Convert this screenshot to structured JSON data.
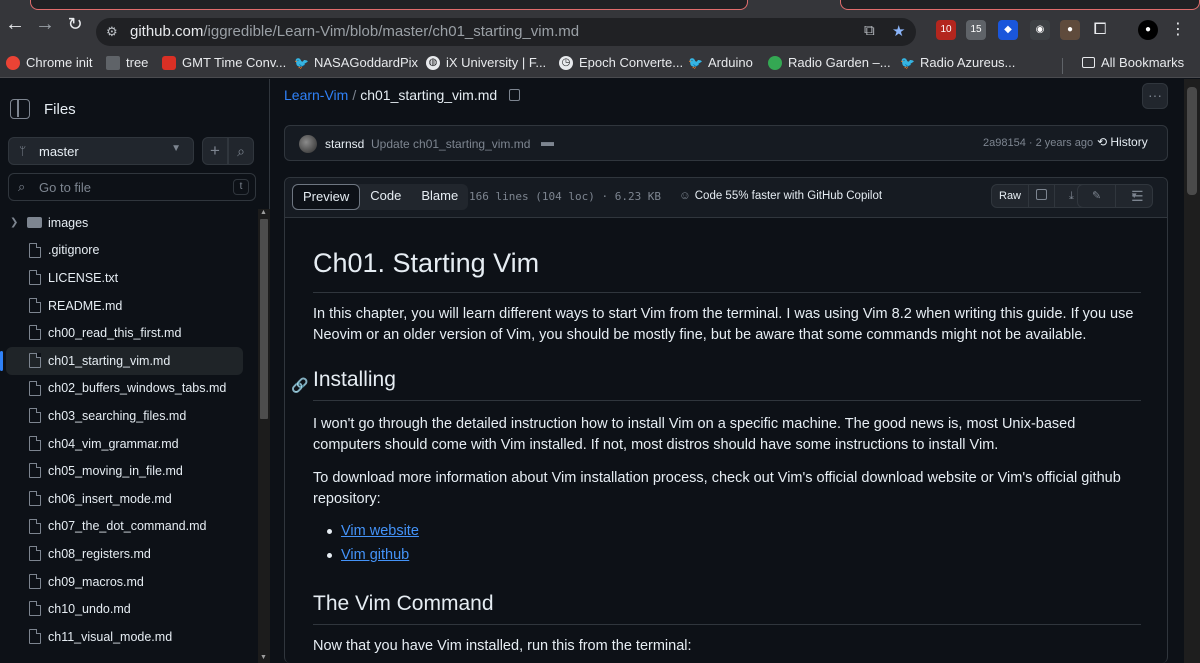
{
  "browser": {
    "url_host": "github.com",
    "url_path": "/iggredible/Learn-Vim/blob/master/ch01_starting_vim.md",
    "ext_badges": [
      "10",
      "15"
    ],
    "bookmarks": [
      "Chrome init",
      "tree",
      "GMT Time Conv...",
      "NASAGoddardPix",
      "iX University | F...",
      "Epoch Converte...",
      "Arduino",
      "Radio Garden –...",
      "Radio Azureus..."
    ],
    "all_bookmarks": "All Bookmarks"
  },
  "sidebar": {
    "title": "Files",
    "branch": "master",
    "goto_placeholder": "Go to file",
    "goto_kbd": "t",
    "items": [
      {
        "name": "images",
        "type": "dir"
      },
      {
        "name": ".gitignore",
        "type": "file"
      },
      {
        "name": "LICENSE.txt",
        "type": "file"
      },
      {
        "name": "README.md",
        "type": "file"
      },
      {
        "name": "ch00_read_this_first.md",
        "type": "file"
      },
      {
        "name": "ch01_starting_vim.md",
        "type": "file",
        "active": true
      },
      {
        "name": "ch02_buffers_windows_tabs.md",
        "type": "file"
      },
      {
        "name": "ch03_searching_files.md",
        "type": "file"
      },
      {
        "name": "ch04_vim_grammar.md",
        "type": "file"
      },
      {
        "name": "ch05_moving_in_file.md",
        "type": "file"
      },
      {
        "name": "ch06_insert_mode.md",
        "type": "file"
      },
      {
        "name": "ch07_the_dot_command.md",
        "type": "file"
      },
      {
        "name": "ch08_registers.md",
        "type": "file"
      },
      {
        "name": "ch09_macros.md",
        "type": "file"
      },
      {
        "name": "ch10_undo.md",
        "type": "file"
      },
      {
        "name": "ch11_visual_mode.md",
        "type": "file"
      }
    ]
  },
  "breadcrumb": {
    "repo": "Learn-Vim",
    "separator": "/",
    "file": "ch01_starting_vim.md"
  },
  "commit": {
    "user": "starnsd",
    "message": "Update ch01_starting_vim.md",
    "sha_time": "2a98154 · 2 years ago",
    "history": "History"
  },
  "file_header": {
    "tabs": [
      "Preview",
      "Code",
      "Blame"
    ],
    "meta": "166 lines (104 loc) · 6.23 KB",
    "copilot": "Code 55% faster with GitHub Copilot",
    "raw": "Raw"
  },
  "content": {
    "h1": "Ch01. Starting Vim",
    "p1": "In this chapter, you will learn different ways to start Vim from the terminal. I was using Vim 8.2 when writing this guide. If you use Neovim or an older version of Vim, you should be mostly fine, but be aware that some commands might not be available.",
    "h2_installing": "Installing",
    "p2": "I won't go through the detailed instruction how to install Vim on a specific machine. The good news is, most Unix-based computers should come with Vim installed. If not, most distros should have some instructions to install Vim.",
    "p3": "To download more information about Vim installation process, check out Vim's official download website or Vim's official github repository:",
    "links": [
      "Vim website",
      "Vim github"
    ],
    "h2_command": "The Vim Command",
    "p4": "Now that you have Vim installed, run this from the terminal:"
  },
  "colors": {
    "accent": "#2f81f7",
    "link": "#4493f8",
    "bg": "#0d1117",
    "border": "#30363d"
  }
}
